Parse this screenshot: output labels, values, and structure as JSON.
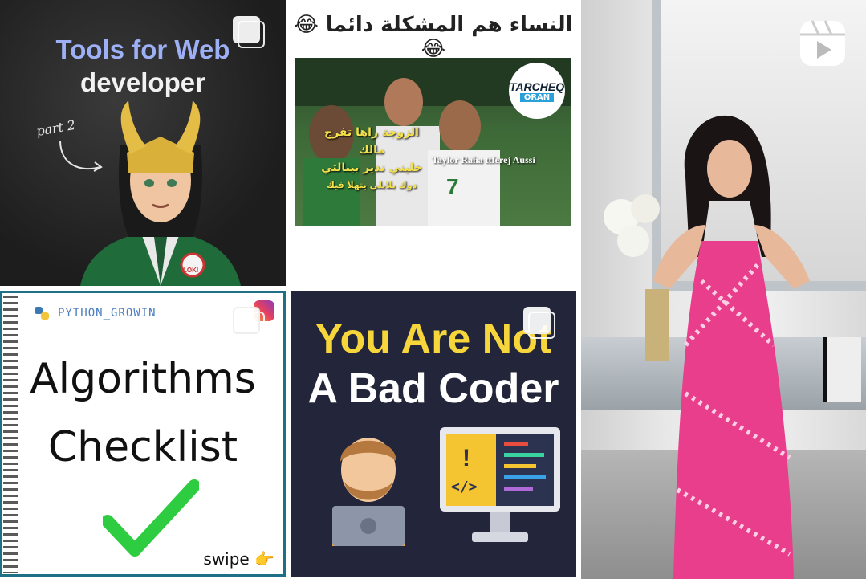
{
  "grid": {
    "tiles": [
      {
        "id": "tools-for-web-developer",
        "title_line1_a": "Tools for ",
        "title_line1_b": "Web",
        "title_line2": "developer",
        "part_label": "part 2",
        "badge_text": "LOKI",
        "type_icon": "multi-photo-icon"
      },
      {
        "id": "arabic-meme",
        "caption": "النساء هم المشكلة دائما 😂😂",
        "logo_line1": "TARCHEQ",
        "logo_line2": "ORAN",
        "overlay_arabic_1": "الزوجة راها تفرج مالك",
        "overlay_arabic_2": "خليني ندير بينالتي",
        "overlay_arabic_3": "دوك بلابلي يتهلا فيك",
        "overlay_english": "Taylor Raha ttferej Aussi"
      },
      {
        "id": "reel-dancing",
        "type_icon": "reel-icon"
      },
      {
        "id": "algorithms-checklist",
        "brand": "PYTHON_GROWIN",
        "title_line1": "Algorithms",
        "title_line2": "Checklist",
        "swipe_label": "swipe 👉",
        "type_icon": "multi-photo-icon"
      },
      {
        "id": "not-a-bad-coder",
        "title_line1": "You Are Not",
        "title_line2": "A Bad Coder",
        "type_icon": "multi-photo-icon"
      }
    ]
  },
  "colors": {
    "tools_title_blue": "#9eb0f5",
    "coder_yellow": "#f6d63a",
    "checklist_frame": "#1f6f86",
    "check_green": "#2ecc40"
  }
}
